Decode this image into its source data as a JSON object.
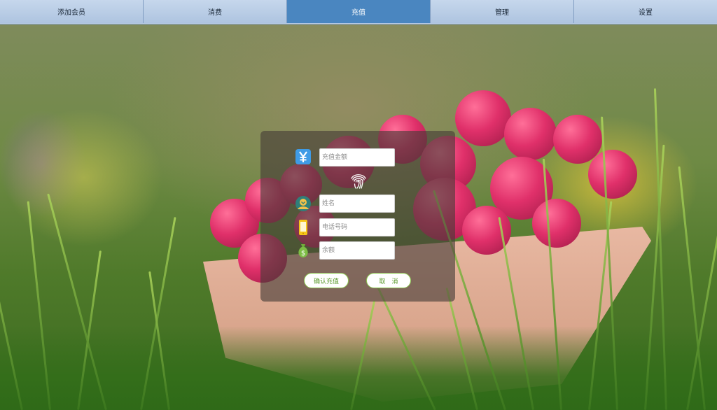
{
  "nav": {
    "tabs": [
      {
        "label": "添加会员",
        "active": false
      },
      {
        "label": "消费",
        "active": false
      },
      {
        "label": "充值",
        "active": true
      },
      {
        "label": "管理",
        "active": false
      },
      {
        "label": "设置",
        "active": false
      }
    ]
  },
  "form": {
    "amount_placeholder": "充值金额",
    "name_placeholder": "姓名",
    "phone_placeholder": "电话号码",
    "balance_placeholder": "余额",
    "confirm_label": "确认充值",
    "cancel_label": "取　消"
  },
  "icons": {
    "amount": "yen-icon",
    "scan": "fingerprint-icon",
    "name": "user-avatar-icon",
    "phone": "mobile-phone-icon",
    "balance": "money-bag-icon"
  },
  "colors": {
    "nav_bg": "#b7cbe4",
    "nav_active": "#4a86c0",
    "button_border": "#8cc850",
    "button_text": "#5a9a2a"
  }
}
